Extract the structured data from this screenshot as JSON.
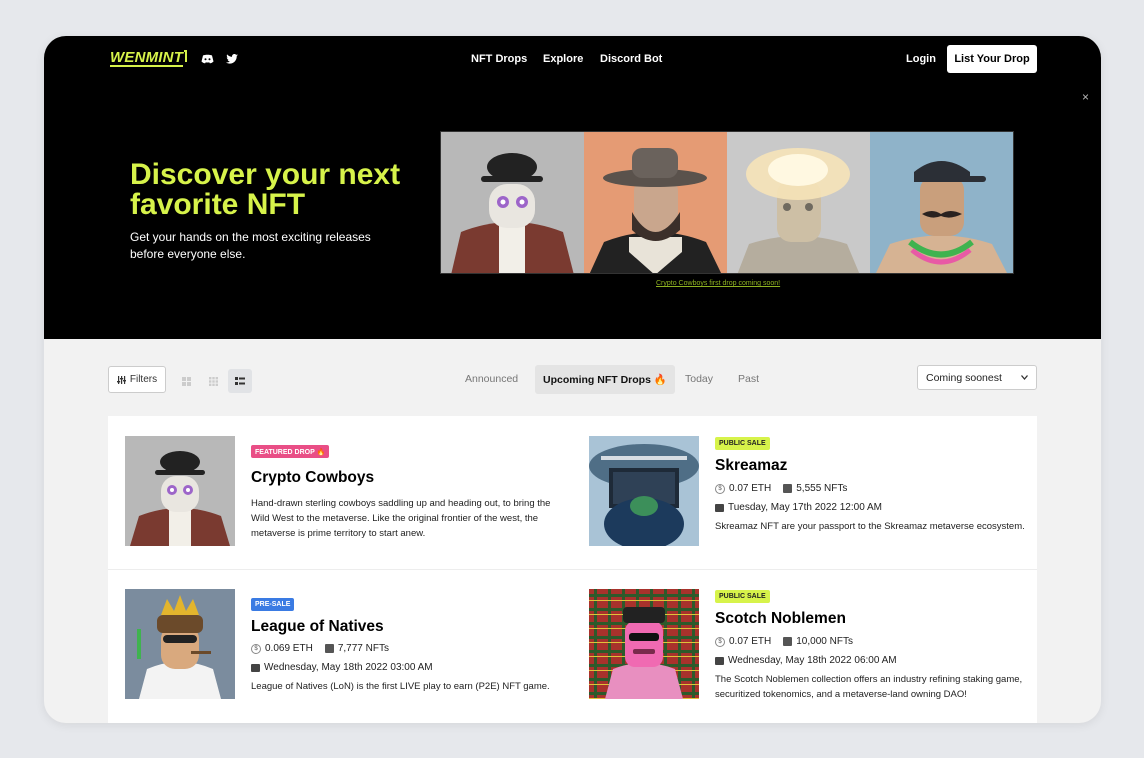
{
  "nav": {
    "logo": "WENMINT",
    "links": [
      "NFT Drops",
      "Explore",
      "Discord Bot"
    ],
    "login": "Login",
    "list_drop": "List Your Drop",
    "close": "×"
  },
  "hero": {
    "title": "Discover your next favorite NFT",
    "subtitle": "Get your hands on the most exciting releases before everyone else.",
    "banner_link": "Crypto Cowboys first drop coming soon!",
    "panel_colors": [
      "#b8b8b8",
      "#e59b74",
      "#c9c9c9",
      "#8fb3c9"
    ]
  },
  "toolbar": {
    "filters_label": "Filters",
    "tabs": [
      "Announced",
      "Upcoming NFT Drops 🔥",
      "Today",
      "Past"
    ],
    "sort_value": "Coming soonest"
  },
  "drops": [
    {
      "badge": "FEATURED DROP 🔥",
      "title": "Crypto Cowboys",
      "description": "Hand-drawn sterling cowboys saddling up and heading out, to bring the Wild West to the metaverse. Like the original frontier of the west, the metaverse is prime territory to start anew."
    },
    {
      "badge": "PUBLIC SALE",
      "title": "Skreamaz",
      "price": "0.07 ETH",
      "supply": "5,555 NFTs",
      "date": "Tuesday, May 17th 2022 12:00 AM",
      "description": "Skreamaz NFT are your passport to the Skreamaz metaverse ecosystem."
    },
    {
      "badge": "PRE-SALE",
      "title": "League of Natives",
      "price": "0.069 ETH",
      "supply": "7,777 NFTs",
      "date": "Wednesday, May 18th 2022 03:00 AM",
      "description": "League of Natives (LoN) is the first LIVE play to earn (P2E) NFT game."
    },
    {
      "badge": "PUBLIC SALE",
      "title": "Scotch Noblemen",
      "price": "0.07 ETH",
      "supply": "10,000 NFTs",
      "date": "Wednesday, May 18th 2022 06:00 AM",
      "description": "The Scotch Noblemen collection offers an industry refining staking game, securitized tokenomics, and a metaverse-land owning DAO!"
    }
  ]
}
